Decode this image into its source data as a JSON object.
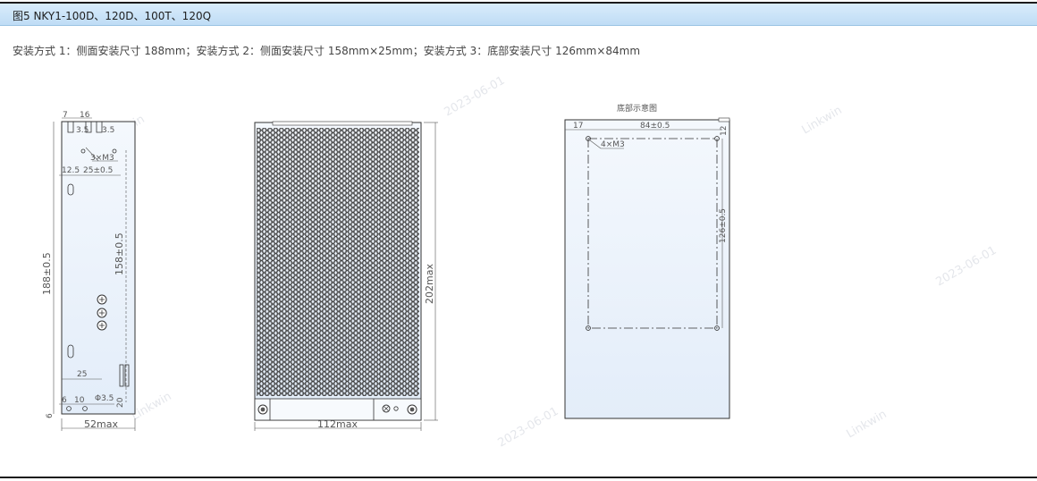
{
  "header": {
    "title": "图5 NKY1-100D、120D、100T、120Q"
  },
  "mounting": {
    "description": "安装方式 1：侧面安装尺寸 188mm；安装方式 2：侧面安装尺寸 158mm×25mm；安装方式 3：底部安装尺寸 126mm×84mm"
  },
  "side_view": {
    "top_dims": [
      "7",
      "16",
      "3.5",
      "3.5"
    ],
    "screw_label": "3×M3",
    "dim_12_5": "12.5",
    "dim_25pm": "25±0.5",
    "height_188": "188±0.5",
    "height_158": "158±0.5",
    "dim_25": "25",
    "dim_6": "6",
    "dim_10": "10",
    "hole_phi": "Φ3.5",
    "dim_20": "20",
    "dim_6v": "6",
    "width_max": "52max"
  },
  "front_view": {
    "height_max": "202max",
    "width_max": "112max"
  },
  "bottom_view": {
    "title": "底部示意图",
    "dim_17": "17",
    "dim_84": "84±0.5",
    "dim_12": "12",
    "screw_label": "4×M3",
    "dim_126": "126±0.5"
  },
  "colors": {
    "header_bg": "#cfe5f8",
    "panel_fill": "#eaf2fb",
    "line": "#333333"
  }
}
